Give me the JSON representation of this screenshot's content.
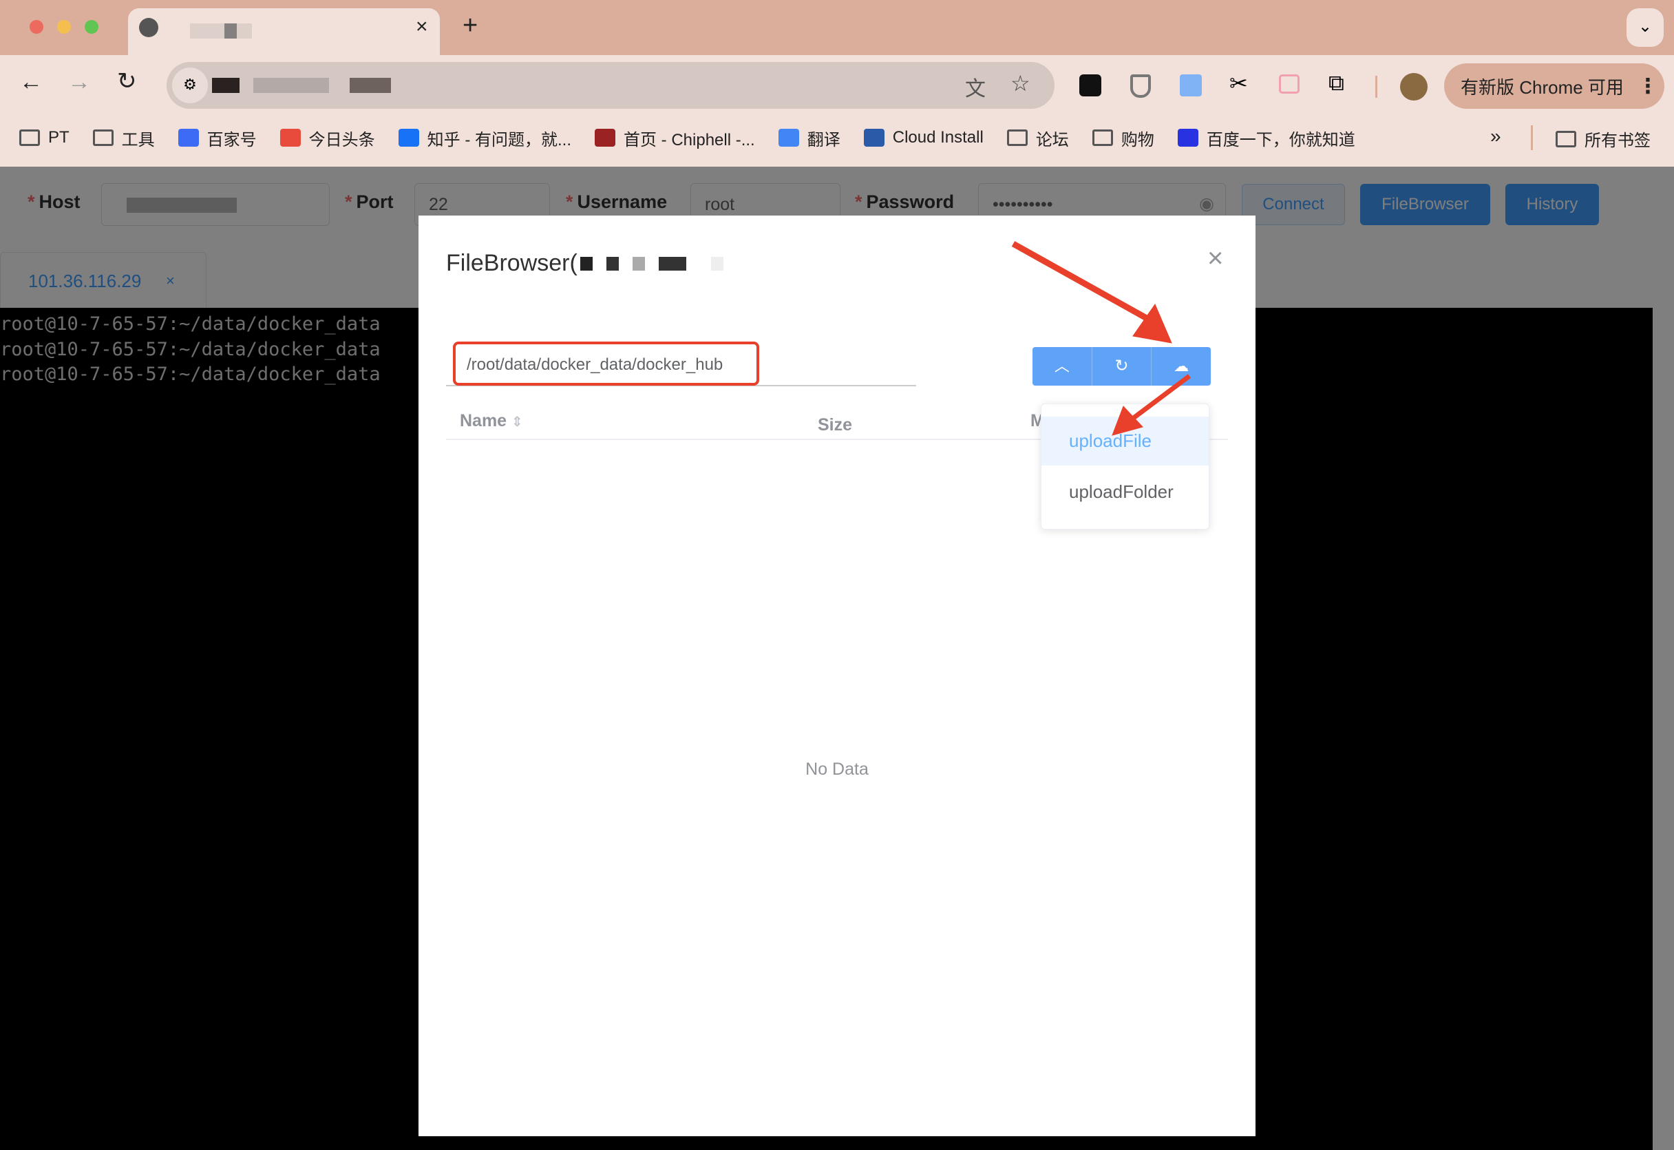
{
  "browser": {
    "new_tab_label": "+",
    "tab_close": "×",
    "bookmarks": [
      {
        "label": "PT",
        "icon": "folder-icon"
      },
      {
        "label": "工具",
        "icon": "folder-icon"
      },
      {
        "label": "百家号",
        "icon": "baijiahao-icon"
      },
      {
        "label": "今日头条",
        "icon": "toutiao-icon"
      },
      {
        "label": "知乎 - 有问题，就...",
        "icon": "zhihu-icon"
      },
      {
        "label": "首页 - Chiphell -...",
        "icon": "chiphell-icon"
      },
      {
        "label": "翻译",
        "icon": "translate-icon"
      },
      {
        "label": "Cloud Install",
        "icon": "cloud-icon"
      },
      {
        "label": "论坛",
        "icon": "folder-icon"
      },
      {
        "label": "购物",
        "icon": "folder-icon"
      },
      {
        "label": "百度一下，你就知道",
        "icon": "baidu-icon"
      }
    ],
    "bookmarks_more": "»",
    "all_bookmarks": "所有书签",
    "update_label": "有新版 Chrome 可用"
  },
  "form": {
    "host_label": "Host",
    "port_label": "Port",
    "port_value": "22",
    "username_label": "Username",
    "username_value": "root",
    "password_label": "Password",
    "password_value": "••••••••••",
    "connect": "Connect",
    "filebrowser": "FileBrowser",
    "history": "History"
  },
  "session_tab": {
    "label": "101.36.116.29",
    "close": "×"
  },
  "terminal": {
    "lines": [
      "root@10-7-65-57:~/data/docker_data",
      "root@10-7-65-57:~/data/docker_data",
      "root@10-7-65-57:~/data/docker_data"
    ]
  },
  "modal": {
    "title": "FileBrowser(",
    "close": "×",
    "path": "/root/data/docker_data/docker_hub",
    "columns": {
      "name": "Name",
      "size": "Size",
      "modified": "M"
    },
    "empty": "No Data",
    "upload_menu": [
      "uploadFile",
      "uploadFolder"
    ]
  },
  "colors": {
    "primary": "#409eff",
    "annotation": "#e8402a",
    "chrome_frame": "#dbae9c",
    "chrome_toolbar": "#f2e1da"
  }
}
